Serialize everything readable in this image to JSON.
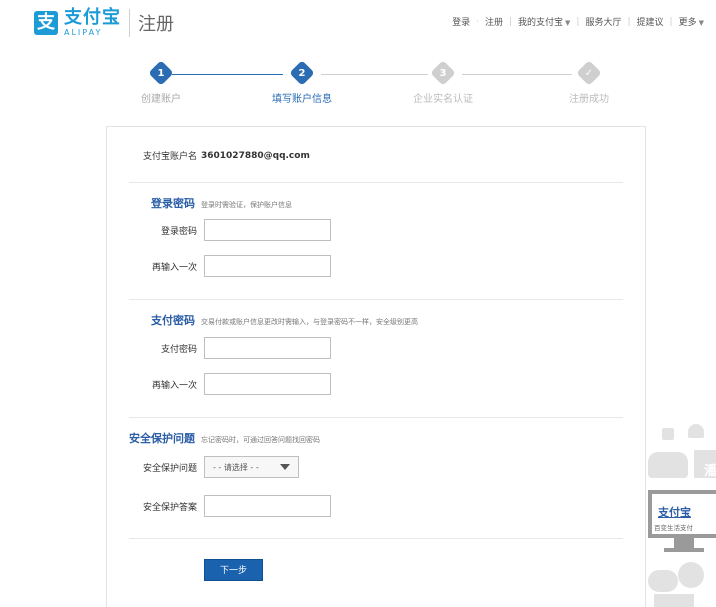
{
  "header": {
    "logo_mark": "支",
    "logo_cn": "支付宝",
    "logo_en": "ALIPAY",
    "page_title": "注册",
    "nav": {
      "login": "登录",
      "register": "注册",
      "my_alipay": "我的支付宝",
      "service_hall": "服务大厅",
      "suggestions": "提建议",
      "more": "更多"
    }
  },
  "steps": [
    {
      "num": "1",
      "label": "创建账户",
      "state": "done"
    },
    {
      "num": "2",
      "label": "填写账户信息",
      "state": "current"
    },
    {
      "num": "3",
      "label": "企业实名认证",
      "state": "todo"
    },
    {
      "num": "✓",
      "label": "注册成功",
      "state": "todo"
    }
  ],
  "form": {
    "account_label": "支付宝账户名",
    "account_value": "3601027880@qq.com",
    "login_section": {
      "title": "登录密码",
      "hint": "登录时需验证，保护账户信息",
      "password_label": "登录密码",
      "confirm_label": "再输入一次",
      "password_value": "",
      "confirm_value": ""
    },
    "pay_section": {
      "title": "支付密码",
      "hint": "交易付款或账户信息更改时需输入，与登录密码不一样，安全级别更高",
      "password_label": "支付密码",
      "confirm_label": "再输入一次",
      "password_value": "",
      "confirm_value": ""
    },
    "security_section": {
      "title": "安全保护问题",
      "hint": "忘记密码时，可通过回答问题找回密码",
      "question_label": "安全保护问题",
      "question_selected": "- - 请选择 - -",
      "answer_label": "安全保护答案",
      "answer_value": ""
    },
    "next_button": "下一步"
  },
  "side_ad": {
    "brand": "支付宝",
    "slogan": "百变生活支付",
    "glyph": "潘"
  },
  "colors": {
    "brand_blue": "#1d9bd7",
    "accent_blue": "#2b6cb3",
    "button_blue": "#1a62ad",
    "step_inactive": "#cfcfcf"
  }
}
